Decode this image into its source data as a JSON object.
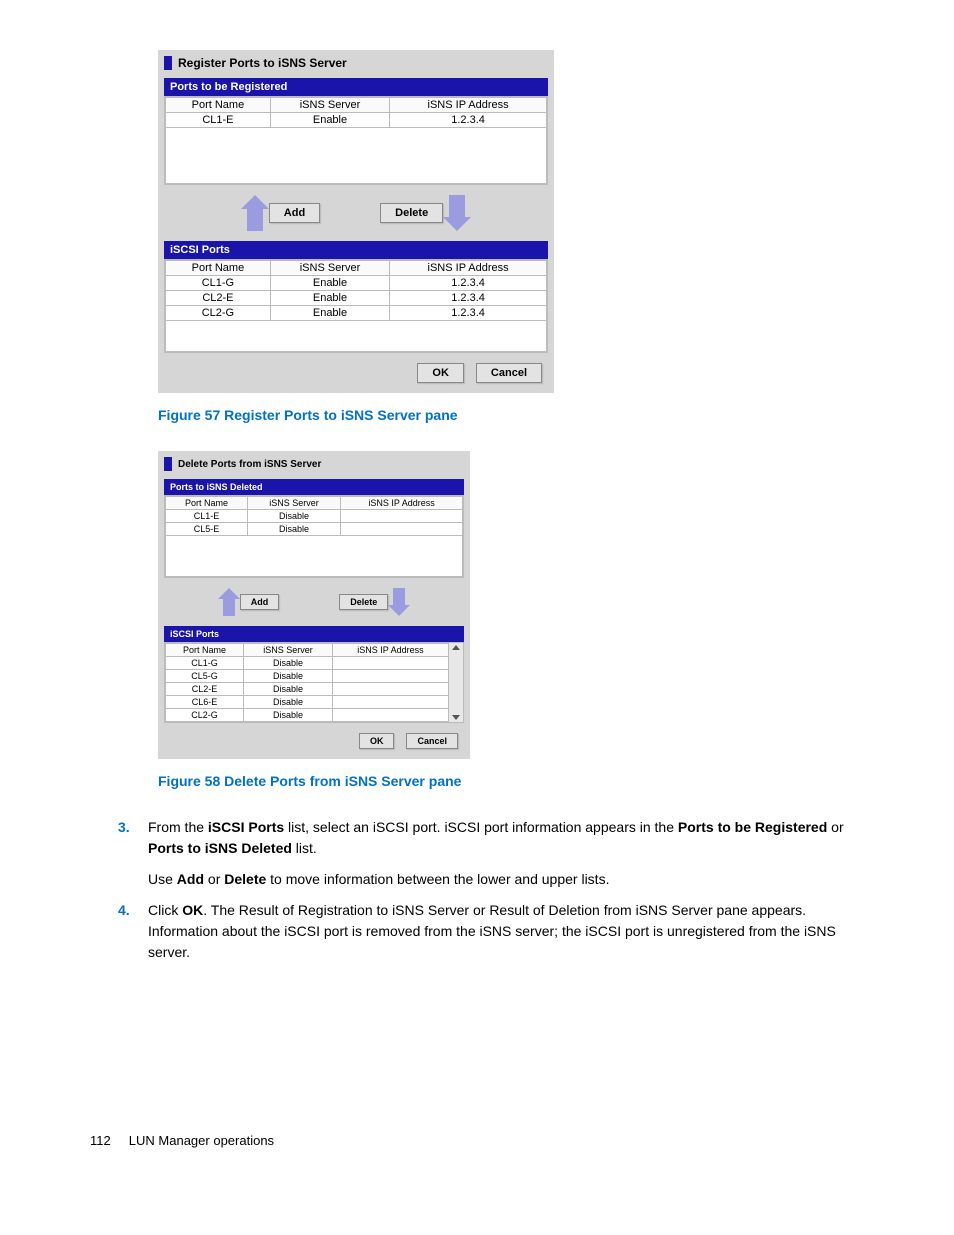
{
  "figure1": {
    "pane_title": "Register Ports to iSNS Server",
    "section_a": "Ports to be Registered",
    "section_b": "iSCSI Ports",
    "cols": [
      "Port Name",
      "iSNS Server",
      "iSNS IP Address"
    ],
    "rows_a": [
      [
        "CL1-E",
        "Enable",
        "1.2.3.4"
      ]
    ],
    "rows_b": [
      [
        "CL1-G",
        "Enable",
        "1.2.3.4"
      ],
      [
        "CL2-E",
        "Enable",
        "1.2.3.4"
      ],
      [
        "CL2-G",
        "Enable",
        "1.2.3.4"
      ]
    ],
    "add": "Add",
    "delete": "Delete",
    "ok": "OK",
    "cancel": "Cancel",
    "caption": "Figure 57 Register Ports to iSNS Server pane"
  },
  "figure2": {
    "pane_title": "Delete Ports from iSNS Server",
    "section_a": "Ports to iSNS Deleted",
    "section_b": "iSCSI Ports",
    "cols": [
      "Port Name",
      "iSNS Server",
      "iSNS IP Address"
    ],
    "rows_a": [
      [
        "CL1-E",
        "Disable",
        ""
      ],
      [
        "CL5-E",
        "Disable",
        ""
      ]
    ],
    "rows_b": [
      [
        "CL1-G",
        "Disable",
        ""
      ],
      [
        "CL5-G",
        "Disable",
        ""
      ],
      [
        "CL2-E",
        "Disable",
        ""
      ],
      [
        "CL6-E",
        "Disable",
        ""
      ],
      [
        "CL2-G",
        "Disable",
        ""
      ]
    ],
    "add": "Add",
    "delete": "Delete",
    "ok": "OK",
    "cancel": "Cancel",
    "caption": "Figure 58 Delete Ports from iSNS Server pane"
  },
  "step3": {
    "num": "3.",
    "t1": "From the ",
    "b1": "iSCSI Ports",
    "t2": " list, select an iSCSI port. iSCSI port information appears in the ",
    "b2": "Ports to be Registered",
    "t3": " or ",
    "b3": "Ports to iSNS Deleted",
    "t4": " list.",
    "p2a": "Use ",
    "p2b1": "Add",
    "p2m": " or ",
    "p2b2": "Delete",
    "p2e": " to move information between the lower and upper lists."
  },
  "step4": {
    "num": "4.",
    "t1": "Click ",
    "b1": "OK",
    "t2": ". The Result of Registration to iSNS Server or Result of Deletion from iSNS Server pane appears. Information about the iSCSI port is removed from the iSNS server; the iSCSI port is unregistered from the iSNS server."
  },
  "footer": {
    "page": "112",
    "title": "LUN Manager operations"
  }
}
